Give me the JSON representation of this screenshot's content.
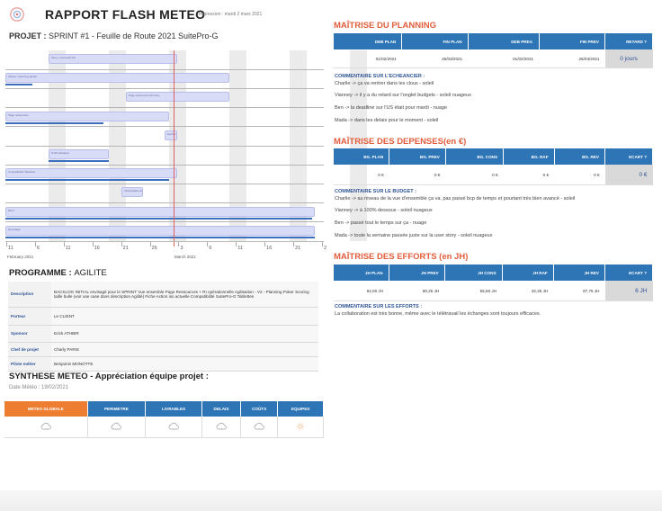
{
  "header": {
    "title": "RAPPORT FLASH METEO",
    "print_date": "Impression : mardi 2 mars 2021",
    "project_label": "PROJET :",
    "project_name": "SPRINT #1 - Feuille de Route 2021 SuitePro-G"
  },
  "gantt": {
    "tasks": [
      {
        "label": "Story 1 (Accueil) 0%",
        "start": 5,
        "end": 20,
        "progress": 0.0
      },
      {
        "label": "Activer / planning global",
        "start": 0,
        "end": 26,
        "progress": 0.12
      },
      {
        "label": "Page ressources (R) story",
        "start": 14,
        "end": 26,
        "progress": 0.0
      },
      {
        "label": "Page ressources",
        "start": 0,
        "end": 19,
        "progress": 0.6
      },
      {
        "label": "Encher story",
        "start": 18.5,
        "end": 20,
        "progress": 0.0
      },
      {
        "label": "Profil utilisateur",
        "start": 5,
        "end": 12,
        "progress": 1.0
      },
      {
        "label": "Compatibilité Tablettes",
        "start": 0,
        "end": 20,
        "progress": 0.95
      },
      {
        "label": "Optimisation de la story",
        "start": 13.5,
        "end": 16,
        "progress": 0.0
      },
      {
        "label": "RCO",
        "start": 0,
        "end": 36,
        "progress": 0.99
      },
      {
        "label": "Recettage",
        "start": 0,
        "end": 36,
        "progress": 1.0
      }
    ],
    "today": 19.5,
    "axis_ticks": [
      "11",
      "6",
      "11",
      "16",
      "21",
      "26",
      "3",
      "6",
      "11",
      "16",
      "21",
      "2"
    ],
    "months": [
      "February 2021",
      "March 2021"
    ]
  },
  "programme": {
    "label": "PROGRAMME :",
    "name": "AGILITE",
    "rows": [
      {
        "key": "Description",
        "value": "BACKLOG INITIAL envisagé pour le SPRINT Vue ensemble Page Ressources + RI opérationnelle Agilisation - V2 - Planning Poker Scoring taille bulle (voir use case dans description Agilité) Fiche Action iso actuelle Compatibilité SuitePro-G Tablettes"
      },
      {
        "key": "Porteur",
        "value": "Le CLIENT"
      },
      {
        "key": "Sponsor",
        "value": "Erick ATHBIR"
      },
      {
        "key": "Chef de projet",
        "value": "Charly PARIS"
      },
      {
        "key": "Pilote métier",
        "value": "Benjamin MONOTTE"
      }
    ]
  },
  "synthese": {
    "title": "SYNTHESE METEO",
    "subtitle": "- Appréciation équipe projet :",
    "date": "Date Météo : 19/02/2021",
    "columns": [
      {
        "label": "METEO GLOBALE",
        "weather": "cloud"
      },
      {
        "label": "PERIMETRE",
        "weather": "cloud"
      },
      {
        "label": "LIVRABLES",
        "weather": "cloud"
      },
      {
        "label": "DELAIS",
        "weather": "cloud"
      },
      {
        "label": "COÛTS",
        "weather": "cloud"
      },
      {
        "label": "EQUIPES",
        "weather": "sun"
      }
    ]
  },
  "planning": {
    "heading": "MAÎTRISE DU PLANNING",
    "headers": [
      "DEB PLAN",
      "FIN PLAN",
      "DEB PREV.",
      "FIN PREV",
      "RETARD ?"
    ],
    "values": [
      "01/02/2021",
      "26/03/2021",
      "01/02/2021",
      "26/03/2021",
      "0 jours"
    ],
    "comment_heading": "COMMENTAIRE SUR L'ECHEANCIER :",
    "comments": [
      "Charlie -> ça va rentrer dans les clous - soleil",
      "Vianney -> il y a du retard sur l'onglet budgets - soleil nuageux",
      "Ben -> la deadline sur l'US était pour mardi - nuage",
      "Mada -> dans les delais pour le moment - soleil"
    ]
  },
  "depenses": {
    "heading": "MAÎTRISE DES DEPENSES(en €)",
    "headers": [
      "BG. PLAN",
      "BG. PREV",
      "BG. CONS",
      "BG. RAF",
      "BG. REV",
      "ECART ?"
    ],
    "values": [
      "0 €",
      "0 €",
      "0 €",
      "0 €",
      "0 €",
      "0 €"
    ],
    "comment_heading": "COMMENTAIRE SUR LE BUDGET :",
    "comments": [
      "Charlie -> au niveau de la vue d'ensemble ça va, pas passé bcp de temps et pourtant très bien avancé - soleil",
      "Vianney -> à 100% dessous - soleil nuageux",
      "Ben -> passé tout le temps sur ça - nuage",
      "Mada -> toute la semaine passée juste sur la user story - soleil nuageux"
    ]
  },
  "efforts": {
    "heading": "MAÎTRISE DES EFFORTS (en JH)",
    "headers": [
      "JH PLAN",
      "JH PREV",
      "JH CONS",
      "JH RAF",
      "JH REV",
      "ECART ?"
    ],
    "values": [
      "82,00 JH",
      "80,25 JH",
      "55,50 JH",
      "32,25 JH",
      "87,75 JH",
      "6 JH"
    ],
    "comment_heading": "COMMENTAIRE SUR LES EFFORTS :",
    "comments": [
      "La collaboration est très bonne, même avec le télétravail les échanges sont toujours efficaces."
    ]
  },
  "colors": {
    "accent_blue": "#2e75b6",
    "accent_orange": "#ed7d31",
    "heading_red": "#e15d3c",
    "today_line": "#e06060"
  }
}
